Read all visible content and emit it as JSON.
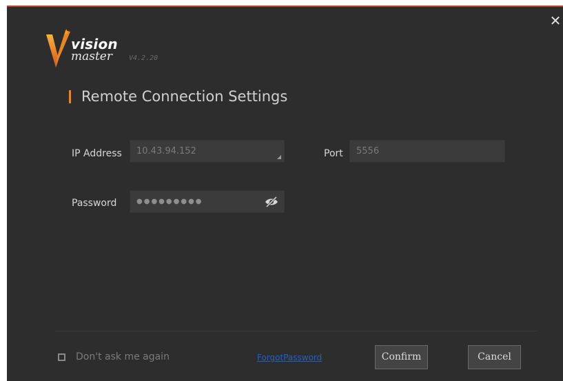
{
  "app": {
    "logo_line1": "vision",
    "logo_line2": "master",
    "version": "V4.2.20",
    "accent_color": "#e08a2a",
    "logo_color": "#e0731a"
  },
  "dialog": {
    "title": "Remote Connection Settings",
    "close_icon": "close-icon"
  },
  "form": {
    "ip_label": "IP Address",
    "ip_value": "10.43.94.152",
    "port_label": "Port",
    "port_value": "5556",
    "password_label": "Password",
    "password_masked": "●●●●●●●●●",
    "eye_icon": "eye-slash-icon"
  },
  "footer": {
    "dont_ask_label": "Don't ask me again",
    "forgot_password_label": "ForgotPassword",
    "confirm_label": "Confirm",
    "cancel_label": "Cancel"
  }
}
